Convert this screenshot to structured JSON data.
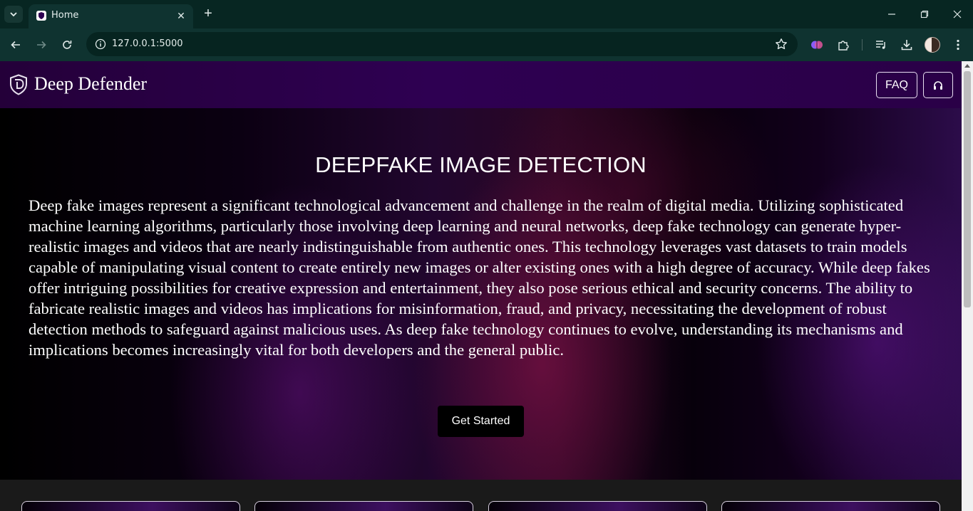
{
  "browser": {
    "tab_title": "Home",
    "url": "127.0.0.1:5000",
    "icons": {
      "tab_list": "chevron-down-icon",
      "tab_favicon": "shield-icon",
      "tab_close": "close-icon",
      "new_tab": "plus-icon",
      "minimize": "minimize-icon",
      "restore": "restore-icon",
      "close": "close-icon",
      "back": "arrow-left-icon",
      "forward": "arrow-right-icon",
      "reload": "reload-icon",
      "site_info": "info-icon",
      "bookmark": "star-icon",
      "extensions": [
        "brain-icon",
        "puzzle-icon",
        "media-control-icon",
        "download-icon"
      ],
      "menu": "kebab-menu-icon"
    }
  },
  "site": {
    "brand_name": "Deep Defender",
    "nav": {
      "faq_label": "FAQ",
      "support_icon": "headset-icon"
    },
    "hero": {
      "title": "DEEPFAKE IMAGE DETECTION",
      "description": "Deep fake images represent a significant technological advancement and challenge in the realm of digital media. Utilizing sophisticated machine learning algorithms, particularly those involving deep learning and neural networks, deep fake technology can generate hyper-realistic images and videos that are nearly indistinguishable from authentic ones. This technology leverages vast datasets to train models capable of manipulating visual content to create entirely new images or alter existing ones with a high degree of accuracy. While deep fakes offer intriguing possibilities for creative expression and entertainment, they also pose serious ethical and security concerns. The ability to fabricate realistic images and videos has implications for misinformation, fraud, and privacy, necessitating the development of robust detection methods to safeguard against malicious uses. As deep fake technology continues to evolve, understanding its mechanisms and implications becomes increasingly vital for both developers and the general public.",
      "cta_label": "Get Started"
    }
  },
  "colors": {
    "header_bg": "#2e0052",
    "hero_accent": "#96144f",
    "text": "#ffffff",
    "chrome_bg": "#0f3330"
  }
}
